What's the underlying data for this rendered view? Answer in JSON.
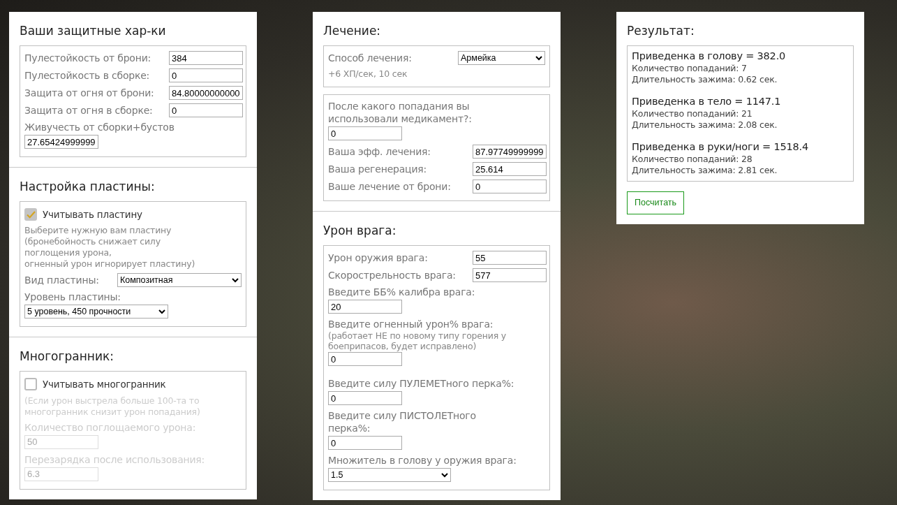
{
  "columns": [
    {
      "sections": [
        {
          "title": "Ваши защитные хар-ки",
          "groups": [
            {
              "rows": [
                {
                  "kind": "inline-field",
                  "label": "Пулестойкость от брони:",
                  "value": "384",
                  "disabled": false
                },
                {
                  "kind": "inline-field",
                  "label": "Пулестойкость в сборке:",
                  "value": "0",
                  "disabled": false
                },
                {
                  "kind": "inline-field",
                  "label": "Защита от огня от брони:",
                  "value": "84.80000000000",
                  "disabled": false
                },
                {
                  "kind": "inline-field",
                  "label": "Защита от огня в сборке:",
                  "value": "0",
                  "disabled": false
                },
                {
                  "kind": "stacked-field",
                  "label": "Живучесть от сборки+бустов",
                  "value": "27.65424999999",
                  "disabled": false
                }
              ]
            }
          ]
        },
        {
          "title": "Настройка пластины:",
          "groups": [
            {
              "rows": [
                {
                  "kind": "checkbox",
                  "label": "Учитывать пластину",
                  "checked": true,
                  "disabled": true
                },
                {
                  "kind": "note",
                  "text": "Выберите нужную вам пластину\n(бронебойность снижает силу\nпоглощения урона,\nогненный урон игнорирует пластину)",
                  "disabled": false
                },
                {
                  "kind": "inline-select",
                  "label": "Вид пластины:",
                  "value": "Композитная",
                  "disabled": false
                },
                {
                  "kind": "stacked-select",
                  "label": "Уровень пластины:",
                  "value": "5 уровень, 450 прочности",
                  "disabled": false
                }
              ]
            }
          ]
        },
        {
          "title": "Многогранник:",
          "groups": [
            {
              "rows": [
                {
                  "kind": "checkbox",
                  "label": "Учитывать многогранник",
                  "checked": false,
                  "disabled": false
                },
                {
                  "kind": "note",
                  "text": "(Если урон выстрела больше 100-та то многогранник снизит урон попадания)",
                  "disabled": true
                },
                {
                  "kind": "stacked-field",
                  "label": "Количество поглощаемого урона:",
                  "value": "50",
                  "disabled": true
                },
                {
                  "kind": "stacked-field",
                  "label": "Перезарядка после использования:",
                  "value": "6.3",
                  "disabled": true
                }
              ]
            }
          ]
        }
      ]
    },
    {
      "sections": [
        {
          "title": "Лечение:",
          "groups": [
            {
              "rows": [
                {
                  "kind": "inline-select",
                  "label": "Способ лечения:",
                  "value": "Армейка",
                  "disabled": false
                },
                {
                  "kind": "note",
                  "text": "+6 ХП/сек, 10 сек",
                  "disabled": false
                }
              ]
            },
            {
              "rows": [
                {
                  "kind": "stacked-field",
                  "label": "После какого попадания вы использовали медикамент?:",
                  "value": "0",
                  "disabled": false
                },
                {
                  "kind": "inline-field",
                  "label": "Ваша эфф. лечения:",
                  "value": "87.97749999999",
                  "disabled": false
                },
                {
                  "kind": "inline-field",
                  "label": "Ваша регенерация:",
                  "value": "25.614",
                  "disabled": false
                },
                {
                  "kind": "inline-field",
                  "label": "Ваше лечение от брони:",
                  "value": "0",
                  "disabled": false
                }
              ]
            }
          ]
        },
        {
          "title": "Урон врага:",
          "groups": [
            {
              "rows": [
                {
                  "kind": "inline-field",
                  "label": "Урон оружия врага:",
                  "value": "55",
                  "disabled": false
                },
                {
                  "kind": "inline-field",
                  "label": "Скорострельность врага:",
                  "value": "577",
                  "disabled": false
                },
                {
                  "kind": "stacked-field",
                  "label": "Введите ББ% калибра врага:",
                  "value": "20",
                  "disabled": false
                },
                {
                  "kind": "stacked-field",
                  "label": "Введите огненный урон% врага:",
                  "note": "(работает НЕ по новому типу горения у боеприпасов, будет исправлено)",
                  "value": "0",
                  "disabled": false
                },
                {
                  "kind": "stacked-field",
                  "label": "Введите силу ПУЛЕМЕТного перка%:",
                  "value": "0",
                  "disabled": false
                },
                {
                  "kind": "stacked-field",
                  "label": "Введите силу ПИСТОЛЕТного перка%:",
                  "value": "0",
                  "disabled": false
                },
                {
                  "kind": "stacked-select",
                  "label": "Множитель в голову у оружия врага:",
                  "value": "1.5",
                  "disabled": false
                }
              ]
            }
          ]
        }
      ]
    },
    {
      "sections": [
        {
          "title": "Результат:",
          "groups": [
            {
              "rows": [
                {
                  "kind": "result",
                  "heading": "Приведенка в голову = 382.0",
                  "lines": [
                    "Количество попаданий: 7",
                    "Длительность зажима: 0.62 сек."
                  ]
                },
                {
                  "kind": "result",
                  "heading": "Приведенка в тело = 1147.1",
                  "lines": [
                    "Количество попаданий: 21",
                    "Длительность зажима: 2.08 сек."
                  ]
                },
                {
                  "kind": "result",
                  "heading": "Приведенка в руки/ноги = 1518.4",
                  "lines": [
                    "Количество попаданий: 28",
                    "Длительность зажима: 2.81 сек."
                  ]
                }
              ]
            }
          ],
          "button": "Посчитать"
        }
      ]
    }
  ]
}
